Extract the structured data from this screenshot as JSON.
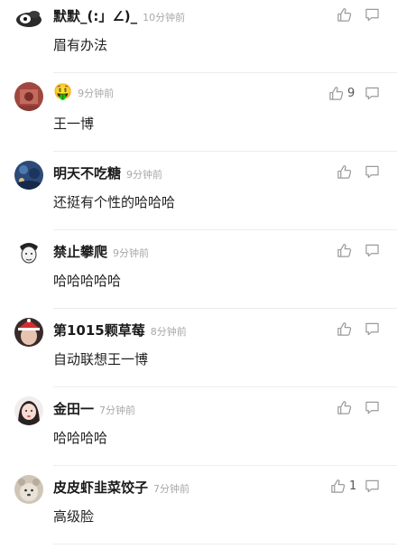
{
  "comments": [
    {
      "username": "默默_(:」∠)_",
      "time": "10分钟前",
      "text": "眉有办法",
      "likes": "",
      "avatar_icon": "penguin-avatar-icon"
    },
    {
      "username": "🤑",
      "time": "9分钟前",
      "text": "王一博",
      "likes": "9",
      "avatar_icon": "red-avatar-icon"
    },
    {
      "username": "明天不吃糖",
      "time": "9分钟前",
      "text": "还挺有个性的哈哈哈",
      "likes": "",
      "avatar_icon": "night-avatar-icon"
    },
    {
      "username": "禁止攀爬",
      "time": "9分钟前",
      "text": "哈哈哈哈哈",
      "likes": "",
      "avatar_icon": "sketch-face-avatar-icon"
    },
    {
      "username": "第1015颗草莓",
      "time": "8分钟前",
      "text": "自动联想王一博",
      "likes": "",
      "avatar_icon": "santa-hat-avatar-icon"
    },
    {
      "username": "金田一",
      "time": "7分钟前",
      "text": "哈哈哈哈",
      "likes": "",
      "avatar_icon": "girl-avatar-icon"
    },
    {
      "username": "皮皮虾韭菜饺子",
      "time": "7分钟前",
      "text": "高级脸",
      "likes": "1",
      "avatar_icon": "animal-avatar-icon"
    }
  ]
}
